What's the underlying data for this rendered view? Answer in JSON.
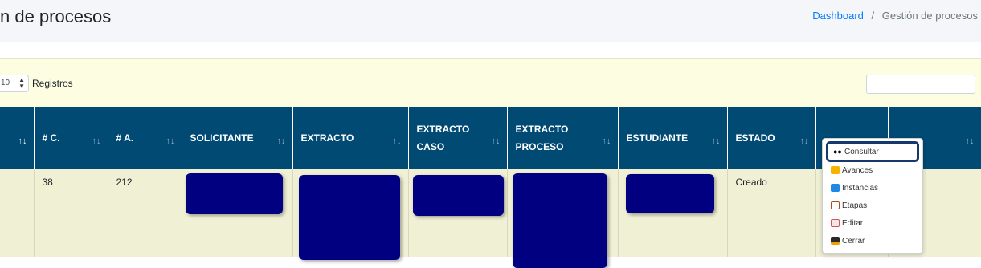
{
  "header": {
    "title": "n de procesos",
    "breadcrumb": {
      "link": "Dashboard",
      "separator": "/",
      "current": "Gestión de procesos"
    }
  },
  "table_controls": {
    "length_value": "10",
    "length_label": "Registros",
    "search_value": ""
  },
  "table": {
    "columns": [
      "",
      "# C.",
      "# A.",
      "SOLICITANTE",
      "EXTRACTO",
      "EXTRACTO CASO",
      "EXTRACTO PROCESO",
      "ESTUDIANTE",
      "ESTADO",
      "",
      ""
    ],
    "rows": [
      {
        "c": "38",
        "a": "212",
        "estado": "Creado"
      }
    ]
  },
  "dropdown": {
    "items": [
      {
        "label": "Consultar",
        "icon": "eyes-icon"
      },
      {
        "label": "Avances",
        "icon": "writing-hand-icon"
      },
      {
        "label": "Instancias",
        "icon": "grid-icon"
      },
      {
        "label": "Etapas",
        "icon": "ladder-icon"
      },
      {
        "label": "Editar",
        "icon": "edit-icon"
      },
      {
        "label": "Cerrar",
        "icon": "close-icon"
      }
    ]
  },
  "colors": {
    "header_bg": "#004a74",
    "panel_bg": "#fdfde2",
    "redaction": "#000080",
    "highlight_border": "#15396d",
    "action_button": "#28a745"
  }
}
